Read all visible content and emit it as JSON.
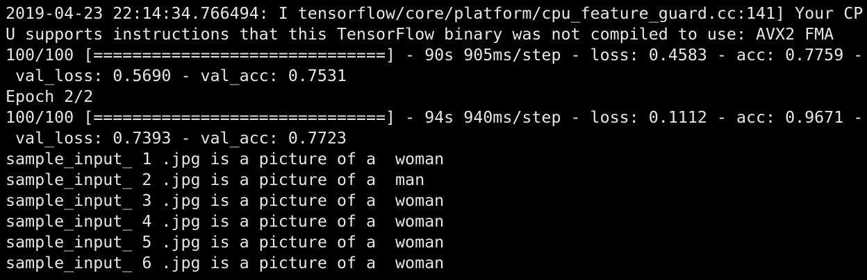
{
  "terminal": {
    "lines": [
      "2019-04-23 22:14:34.766494: I tensorflow/core/platform/cpu_feature_guard.cc:141] Your CP",
      "U supports instructions that this TensorFlow binary was not compiled to use: AVX2 FMA",
      "100/100 [==============================] - 90s 905ms/step - loss: 0.4583 - acc: 0.7759 -",
      " val_loss: 0.5690 - val_acc: 0.7531",
      "Epoch 2/2",
      "100/100 [==============================] - 94s 940ms/step - loss: 0.1112 - acc: 0.9671 -",
      " val_loss: 0.7393 - val_acc: 0.7723",
      "sample_input_ 1 .jpg is a picture of a  woman",
      "sample_input_ 2 .jpg is a picture of a  man",
      "sample_input_ 3 .jpg is a picture of a  woman",
      "sample_input_ 4 .jpg is a picture of a  woman",
      "sample_input_ 5 .jpg is a picture of a  woman",
      "sample_input_ 6 .jpg is a picture of a  woman"
    ]
  }
}
